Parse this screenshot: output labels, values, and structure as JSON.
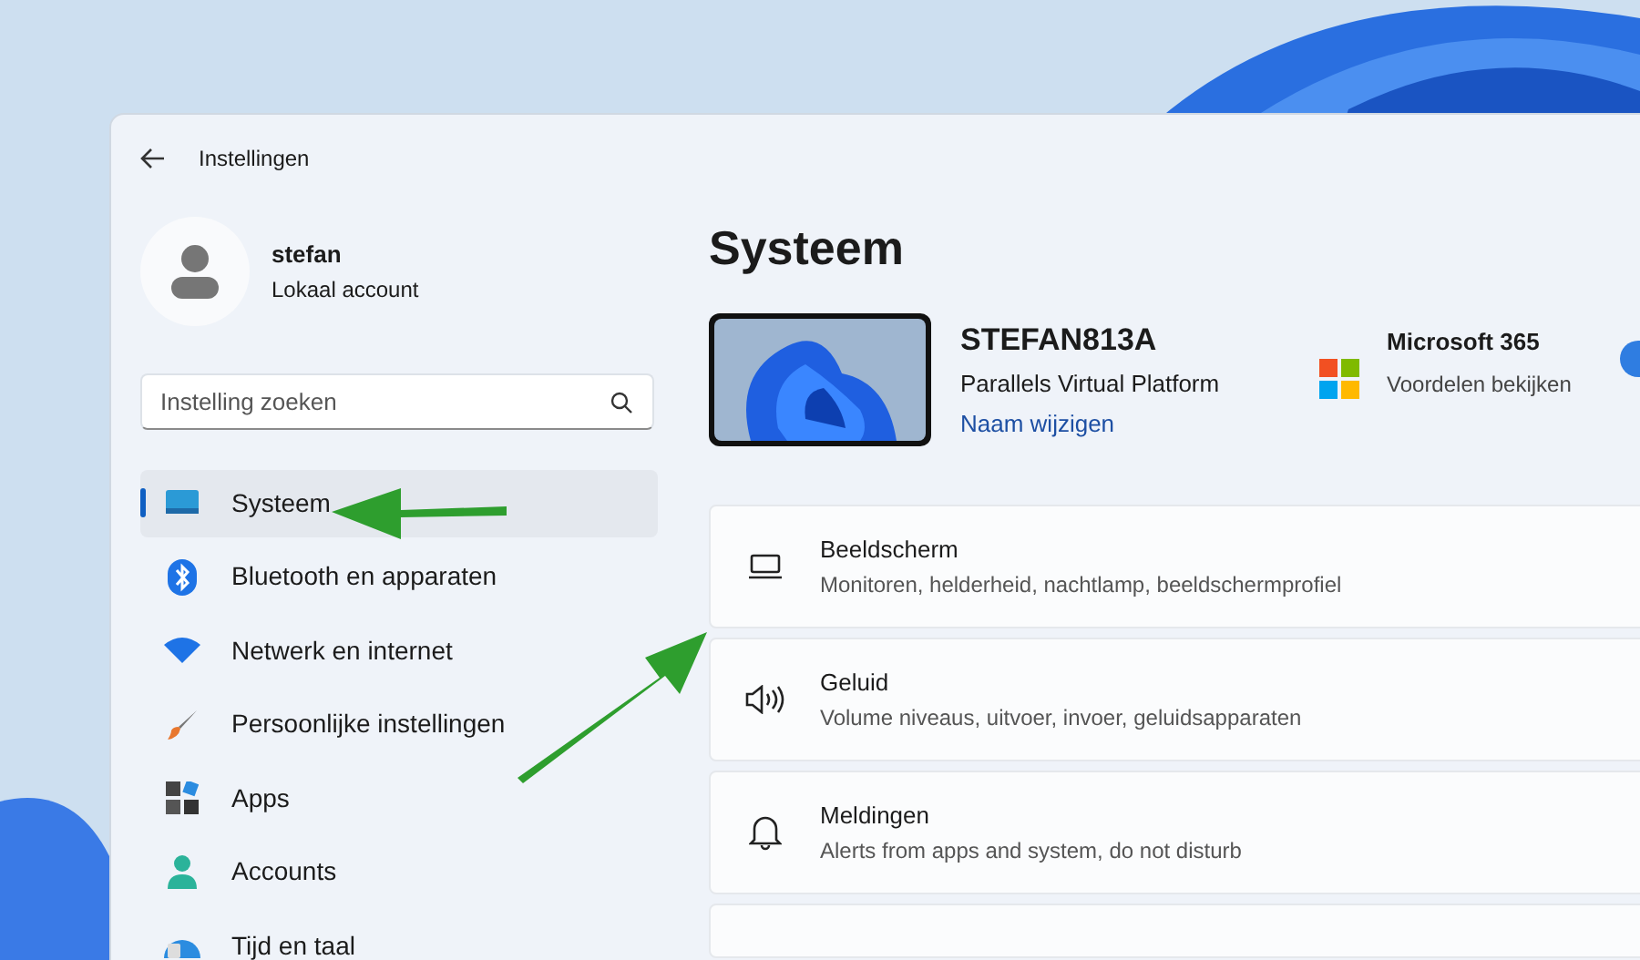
{
  "window": {
    "title": "Instellingen"
  },
  "user": {
    "name": "stefan",
    "account": "Lokaal account"
  },
  "search": {
    "placeholder": "Instelling zoeken"
  },
  "nav": [
    {
      "label": "Systeem",
      "selected": true
    },
    {
      "label": "Bluetooth en apparaten",
      "selected": false
    },
    {
      "label": "Netwerk en internet",
      "selected": false
    },
    {
      "label": "Persoonlijke instellingen",
      "selected": false
    },
    {
      "label": "Apps",
      "selected": false
    },
    {
      "label": "Accounts",
      "selected": false
    },
    {
      "label": "Tijd en taal",
      "selected": false
    }
  ],
  "heading": "Systeem",
  "device": {
    "name": "STEFAN813A",
    "model": "Parallels Virtual Platform",
    "rename_link": "Naam wijzigen"
  },
  "microsoft_365": {
    "title": "Microsoft 365",
    "subtitle": "Voordelen bekijken"
  },
  "cards": [
    {
      "title": "Beeldscherm",
      "subtitle": "Monitoren, helderheid, nachtlamp, beeldschermprofiel"
    },
    {
      "title": "Geluid",
      "subtitle": "Volume niveaus, uitvoer, invoer, geluidsapparaten"
    },
    {
      "title": "Meldingen",
      "subtitle": "Alerts from apps and system, do not disturb"
    }
  ]
}
